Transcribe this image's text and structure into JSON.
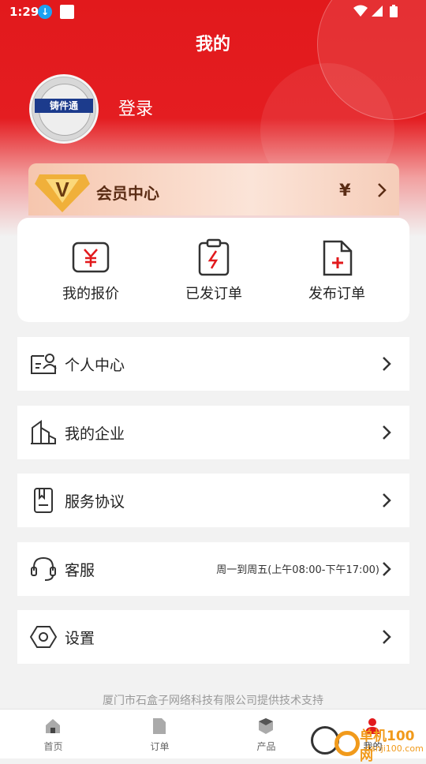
{
  "status_bar": {
    "time": "1:29"
  },
  "header": {
    "title": "我的",
    "login_label": "登录",
    "avatar_text": "铸件通"
  },
  "vip": {
    "title": "会员中心",
    "yen": "¥"
  },
  "quick_actions": [
    {
      "label": "我的报价",
      "icon": "yen-bill-icon"
    },
    {
      "label": "已发订单",
      "icon": "clipboard-lightning-icon"
    },
    {
      "label": "发布订单",
      "icon": "document-add-icon"
    }
  ],
  "menu": [
    {
      "label": "个人中心",
      "icon": "profile-card-icon",
      "note": ""
    },
    {
      "label": "我的企业",
      "icon": "building-icon",
      "note": ""
    },
    {
      "label": "服务协议",
      "icon": "agreement-book-icon",
      "note": ""
    },
    {
      "label": "客服",
      "icon": "headset-icon",
      "note": "周一到周五(上午08:00-下午17:00)"
    },
    {
      "label": "设置",
      "icon": "settings-hexagon-icon",
      "note": ""
    }
  ],
  "footer": {
    "support_text": "厦门市石盒子网络科技有限公司提供技术支持"
  },
  "tabs": [
    {
      "label": "首页",
      "icon": "home-icon"
    },
    {
      "label": "订单",
      "icon": "order-doc-icon"
    },
    {
      "label": "产品",
      "icon": "product-box-icon"
    },
    {
      "label": "我的",
      "icon": "user-icon"
    }
  ],
  "watermark": {
    "line1": "单机100网",
    "line2": "danji100.com"
  },
  "colors": {
    "brand_red": "#e2191c",
    "vip_text": "#5a2c14",
    "tab_active": "#e2191c"
  }
}
